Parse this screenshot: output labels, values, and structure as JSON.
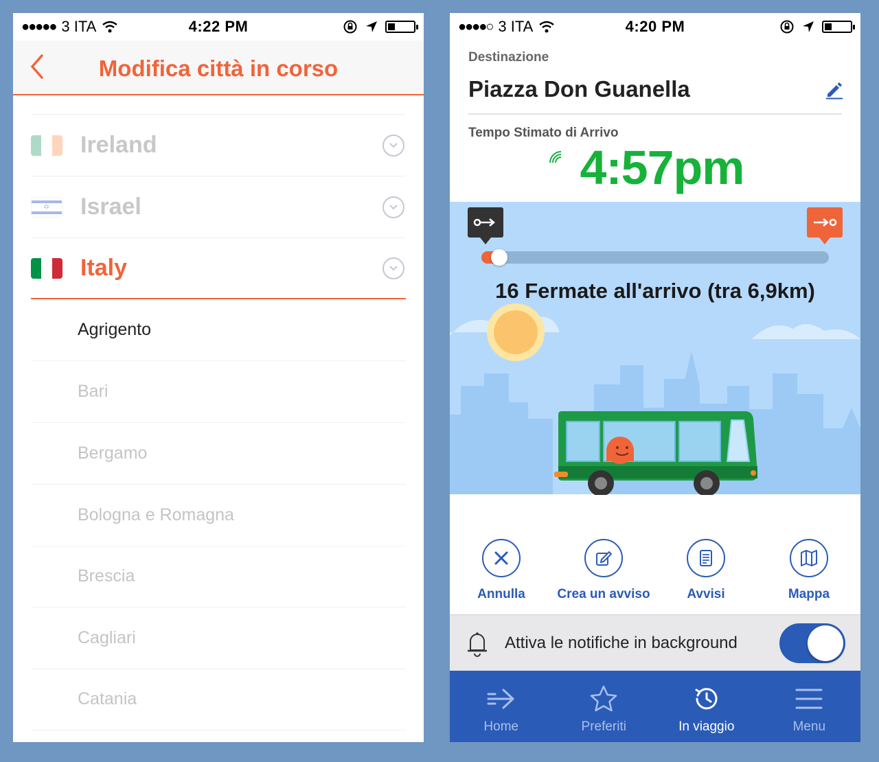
{
  "left": {
    "status": {
      "signal": "●●●●●",
      "carrier": "3 ITA",
      "time": "4:22 PM"
    },
    "title": "Modifica città in corso",
    "countries": [
      {
        "name": "Ireland",
        "flag": [
          "#169b62",
          "#ffffff",
          "#ff883e"
        ]
      },
      {
        "name": "Israel",
        "flag": "israel"
      },
      {
        "name": "Italy",
        "flag": [
          "#009246",
          "#ffffff",
          "#ce2b37"
        ]
      }
    ],
    "cities": [
      "Agrigento",
      "Bari",
      "Bergamo",
      "Bologna e Romagna",
      "Brescia",
      "Cagliari",
      "Catania"
    ]
  },
  "right": {
    "status": {
      "signal": "●●●●○",
      "carrier": "3 ITA",
      "time": "4:20 PM"
    },
    "destination_label": "Destinazione",
    "destination": "Piazza Don Guanella",
    "eta_label": "Tempo Stimato di Arrivo",
    "eta": "4:57pm",
    "progress": 0.04,
    "stops_text": "16 Fermate all'arrivo (tra 6,9km)",
    "actions": [
      {
        "label": "Annulla",
        "icon": "close-icon"
      },
      {
        "label": "Crea un avviso",
        "icon": "edit-alert-icon"
      },
      {
        "label": "Avvisi",
        "icon": "document-icon"
      },
      {
        "label": "Mappa",
        "icon": "map-icon"
      }
    ],
    "notification_label": "Attiva le notifiche in background",
    "notification_on": true,
    "tabs": [
      {
        "label": "Home",
        "icon": "arrow-icon"
      },
      {
        "label": "Preferiti",
        "icon": "star-icon"
      },
      {
        "label": "In viaggio",
        "icon": "clock-icon",
        "active": true
      },
      {
        "label": "Menu",
        "icon": "hamburger-icon"
      }
    ]
  },
  "colors": {
    "accent_orange": "#f0643a",
    "brand_blue": "#2a5bb7",
    "eta_green": "#16b23a",
    "bus_green": "#1e9a46",
    "background": "#7096c2"
  }
}
